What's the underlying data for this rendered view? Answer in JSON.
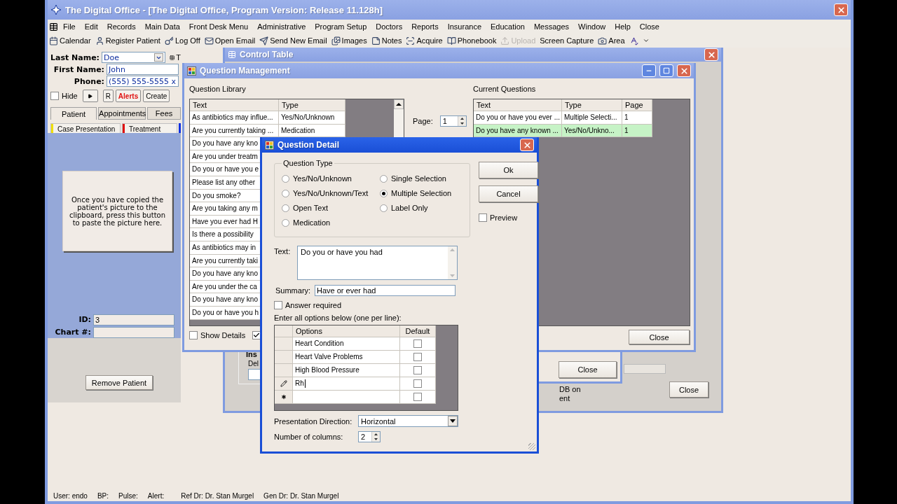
{
  "app": {
    "title": "The Digital Office - [The Digital Office, Program Version: Release 11.128h]"
  },
  "menu": [
    "File",
    "Edit",
    "Records",
    "Main Data",
    "Front Desk Menu",
    "Administrative",
    "Program Setup",
    "Doctors",
    "Reports",
    "Insurance",
    "Education",
    "Messages",
    "Window",
    "Help",
    "Close"
  ],
  "toolbar": [
    {
      "label": "Calendar",
      "disabled": false
    },
    {
      "label": "Register Patient",
      "disabled": false
    },
    {
      "label": "Log Off",
      "disabled": false
    },
    {
      "label": "Open Email",
      "disabled": false
    },
    {
      "label": "Send New Email",
      "disabled": false
    },
    {
      "label": "Images",
      "disabled": false
    },
    {
      "label": "Notes",
      "disabled": false
    },
    {
      "label": "Acquire",
      "disabled": false
    },
    {
      "label": "Phonebook",
      "disabled": false
    },
    {
      "label": "Upload",
      "disabled": true
    },
    {
      "label": "Screen Capture",
      "disabled": false
    },
    {
      "label": "Area",
      "disabled": false
    }
  ],
  "patient": {
    "fields": [
      {
        "label": "Last Name:",
        "value": "Doe",
        "kind": "combo"
      },
      {
        "label": "First Name:",
        "value": "John",
        "kind": "text"
      },
      {
        "label": "Phone:",
        "value": "(555) 555-5555 x",
        "kind": "text"
      }
    ],
    "side_button": "T",
    "hide": {
      "label": "Hide",
      "checked": false
    },
    "buttons": [
      {
        "label": "R",
        "kind": "normal"
      },
      {
        "label": "Alerts",
        "kind": "alert"
      },
      {
        "label": "Create",
        "kind": "normal"
      }
    ],
    "tabs": [
      {
        "label": "Patient",
        "selected": true
      },
      {
        "label": "Appointments",
        "selected": false
      },
      {
        "label": "Fees",
        "selected": false
      }
    ],
    "subtabs": [
      {
        "label": "Case Presentation",
        "color": "#f0e000"
      },
      {
        "label": "Treatment",
        "color": "#e01010"
      },
      {
        "color": "#1030e0"
      }
    ],
    "picture_button": "Once you have copied the patient's picture to the clipboard, press this button to paste the picture here.",
    "ids": [
      {
        "label": "ID:",
        "value": "3"
      },
      {
        "label": "Chart #:"
      }
    ],
    "remove_button": "Remove Patient"
  },
  "control_table": {
    "title": "Control Table",
    "group_title": "Ins",
    "group_label": "Del",
    "note_lines": [
      "DB on",
      "ent"
    ],
    "close_button": "Close"
  },
  "back_dialog": {
    "close_button": "Close"
  },
  "question_management": {
    "title": "Question Management",
    "library": {
      "label": "Question Library",
      "columns": [
        "Text",
        "Type"
      ],
      "rows": [
        {
          "text": "As antibiotics may influe...",
          "type": "Yes/No/Unknown"
        },
        {
          "text": "Are you currently taking ...",
          "type": "Medication"
        },
        {
          "text": "Do you have any kno"
        },
        {
          "text": "Are you under treatm"
        },
        {
          "text": "Do you or have you e"
        },
        {
          "text": "Please list any other"
        },
        {
          "text": "Do you smoke?"
        },
        {
          "text": "Are you taking any m"
        },
        {
          "text": "Have you ever had H"
        },
        {
          "text": "Is there a possibility"
        },
        {
          "text": "As antibiotics may in"
        },
        {
          "text": "Are you currently taki"
        },
        {
          "text": "Do you have any kno"
        },
        {
          "text": "Are you under the ca"
        },
        {
          "text": "Do you have any kno"
        },
        {
          "text": "Do you or have you h"
        }
      ]
    },
    "page": {
      "label": "Page:",
      "value": "1"
    },
    "current": {
      "label": "Current Questions",
      "columns": [
        "Text",
        "Type",
        "Page"
      ],
      "rows": [
        {
          "text": "Do you or have you ever ...",
          "type": "Multiple Selecti...",
          "page": "1",
          "selected": false
        },
        {
          "text": "Do you have any known ...",
          "type": "Yes/No/Unkno...",
          "page": "1",
          "selected": true
        }
      ]
    },
    "show_details": {
      "label": "Show Details",
      "checked": false
    },
    "second_checkbox": {
      "checked": true
    },
    "close_button": "Close"
  },
  "question_detail": {
    "title": "Question Detail",
    "type_group": {
      "title": "Question Type",
      "options": [
        {
          "label": "Yes/No/Unknown",
          "selected": false
        },
        {
          "label": "Single Selection",
          "selected": false
        },
        {
          "label": "Yes/No/Unknown/Text",
          "selected": false
        },
        {
          "label": "Multiple Selection",
          "selected": true
        },
        {
          "label": "Open Text",
          "selected": false
        },
        {
          "label": "Label Only",
          "selected": false
        },
        {
          "label": "Medication",
          "selected": false
        }
      ]
    },
    "buttons": [
      "Ok",
      "Cancel"
    ],
    "preview": {
      "label": "Preview",
      "checked": false
    },
    "text": {
      "label": "Text:",
      "value": "Do you or have you had"
    },
    "summary": {
      "label": "Summary:",
      "value": "Have or ever had"
    },
    "answer_required": {
      "label": "Answer required",
      "checked": false
    },
    "options_label": "Enter all options below (one per line):",
    "options_grid": {
      "columns": [
        "Options",
        "Default"
      ],
      "rows": [
        {
          "value": "Heart Condition",
          "default": false,
          "kind": "normal"
        },
        {
          "value": "Heart Valve Problems",
          "default": false,
          "kind": "normal"
        },
        {
          "value": "High Blood Pressure",
          "default": false,
          "kind": "normal"
        },
        {
          "value": "Rh",
          "default": false,
          "kind": "editing"
        },
        {
          "default": false,
          "kind": "new"
        }
      ]
    },
    "direction": {
      "label": "Presentation Direction:",
      "value": "Horizontal"
    },
    "columns": {
      "label": "Number of columns:",
      "value": "2"
    }
  },
  "status_bar": [
    "User: endo",
    "BP:",
    "Pulse:",
    "Alert:",
    "Ref Dr: Dr. Stan Murgel",
    "Gen Dr: Dr. Stan Murgel"
  ]
}
